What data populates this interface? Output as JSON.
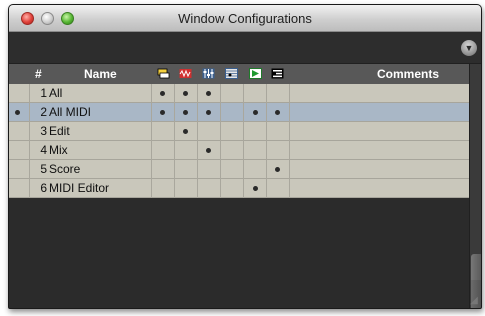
{
  "window": {
    "title": "Window Configurations"
  },
  "table": {
    "headers": {
      "number": "#",
      "name": "Name",
      "comments": "Comments"
    },
    "icon_names": [
      "edit-window-icon",
      "mix-window-icon",
      "mixer-sliders-icon",
      "score-editor-icon",
      "midi-editor-icon",
      "midi-event-list-icon"
    ],
    "rows": [
      {
        "number": "1",
        "name": "All",
        "selected": false,
        "dots": [
          true,
          true,
          true,
          false,
          false,
          false
        ]
      },
      {
        "number": "2",
        "name": "All MIDI",
        "selected": true,
        "dots": [
          true,
          true,
          true,
          false,
          true,
          true
        ]
      },
      {
        "number": "3",
        "name": "Edit",
        "selected": false,
        "dots": [
          false,
          true,
          false,
          false,
          false,
          false
        ]
      },
      {
        "number": "4",
        "name": "Mix",
        "selected": false,
        "dots": [
          false,
          false,
          true,
          false,
          false,
          false
        ]
      },
      {
        "number": "5",
        "name": "Score",
        "selected": false,
        "dots": [
          false,
          false,
          false,
          false,
          false,
          true
        ]
      },
      {
        "number": "6",
        "name": "MIDI Editor",
        "selected": false,
        "dots": [
          false,
          false,
          false,
          false,
          true,
          false
        ]
      }
    ]
  },
  "colors": {
    "row_bg": "#c9c7bb",
    "selected_row_bg": "#a9b7c6",
    "header_bg": "#585858",
    "window_bg": "#2b2b2b"
  }
}
